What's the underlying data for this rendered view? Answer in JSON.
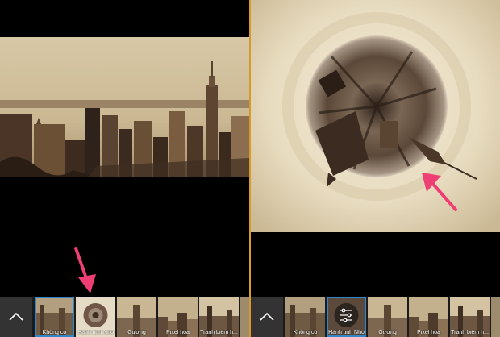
{
  "left": {
    "filters": [
      {
        "label": "Không có",
        "selected": true,
        "style": "none"
      },
      {
        "label": "Hành tinh Nhỏ",
        "selected": false,
        "style": "planet"
      },
      {
        "label": "Gương",
        "selected": false,
        "style": "mirror"
      },
      {
        "label": "Pixel hóa",
        "selected": false,
        "style": "pixel"
      },
      {
        "label": "Tranh biếm h...",
        "selected": false,
        "style": "cartoon"
      },
      {
        "label": "",
        "selected": false,
        "style": "more"
      }
    ]
  },
  "right": {
    "filters": [
      {
        "label": "Không có",
        "selected": false,
        "style": "none"
      },
      {
        "label": "Hành tinh Nhỏ",
        "selected": true,
        "style": "planet-settings"
      },
      {
        "label": "Gương",
        "selected": false,
        "style": "mirror"
      },
      {
        "label": "Pixel hóa",
        "selected": false,
        "style": "pixel"
      },
      {
        "label": "Tranh biếm h...",
        "selected": false,
        "style": "cartoon"
      },
      {
        "label": "",
        "selected": false,
        "style": "more"
      }
    ]
  },
  "colors": {
    "divider": "#d89a2b",
    "selection": "#2f86c9",
    "arrow": "#ee3f74",
    "sepia_light": "#e9dcc0",
    "sepia_dark": "#3a2a1e"
  }
}
